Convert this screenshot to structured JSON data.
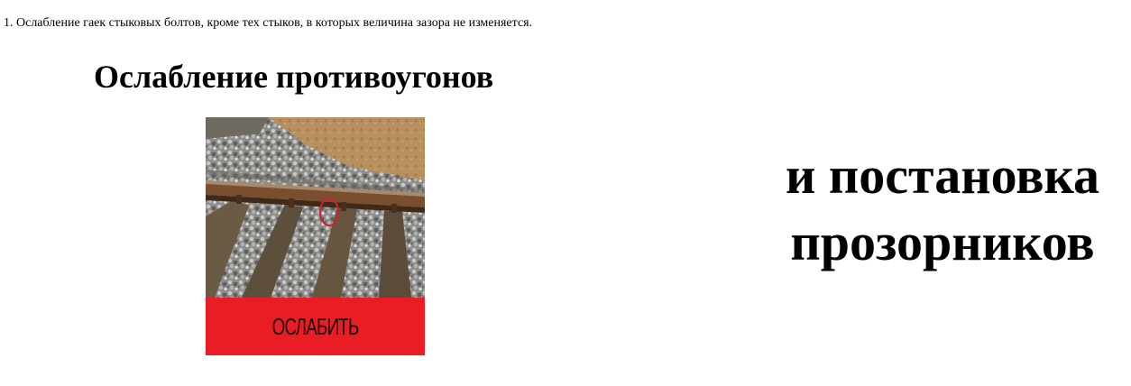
{
  "intro": {
    "text": "1. Ослабление гаек стыковых болтов, кроме тех стыков, в которых величина зазора не изменяется."
  },
  "heading": {
    "left": "Ослабление противоугонов",
    "right_line1": "и постановка",
    "right_line2": "прозорников"
  },
  "photo_card": {
    "button_label": "ОСЛАБИТЬ",
    "button_color": "#ea1c24",
    "marker_color": "#d0202a"
  }
}
